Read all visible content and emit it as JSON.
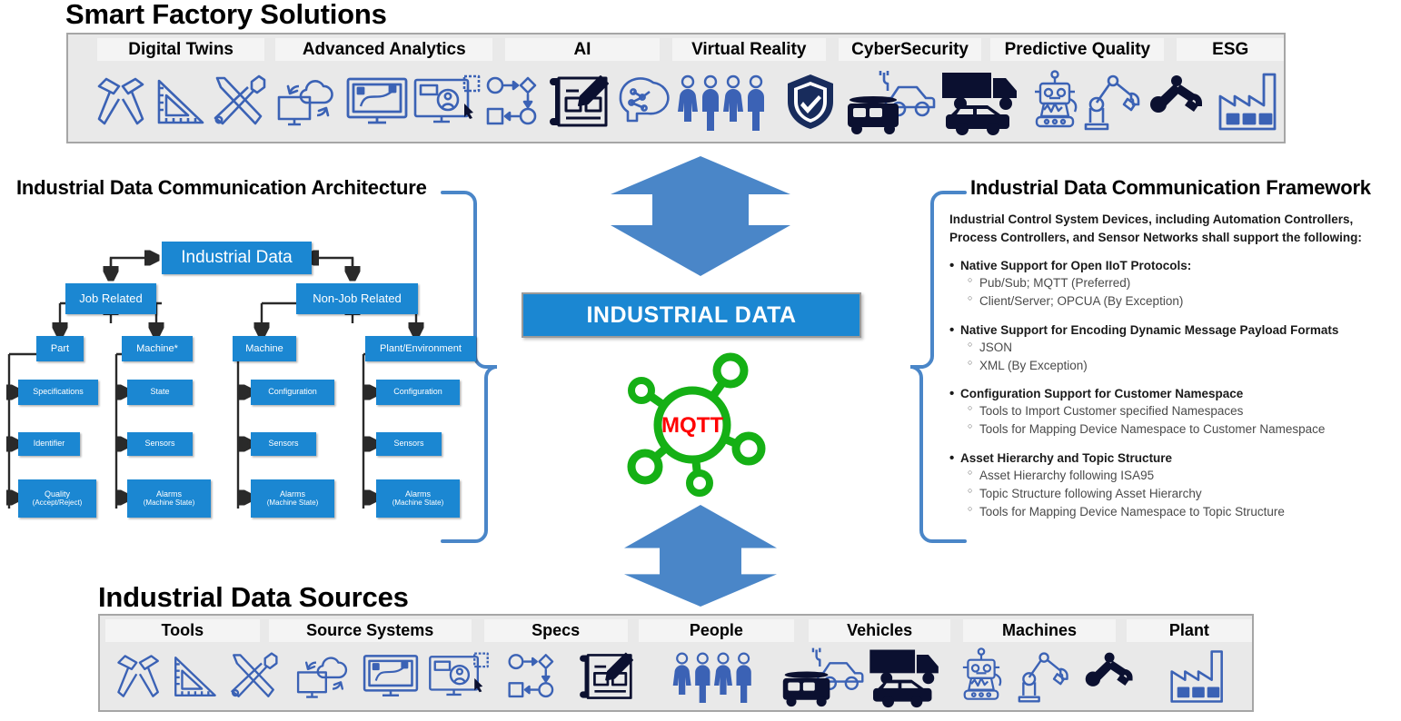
{
  "solutions": {
    "title": "Smart Factory Solutions",
    "categories": [
      {
        "label": "Digital Twins",
        "icons": [
          "hammers-icon",
          "ruler-triangle-icon",
          "tools-wrench-icon"
        ]
      },
      {
        "label": "Advanced Analytics",
        "icons": [
          "cloud-monitor-sync-icon",
          "monitor-curve-icon",
          "monitor-dashboard-user-icon"
        ]
      },
      {
        "label": "AI",
        "icons": [
          "flow-diagram-icon",
          "blueprint-pencil-icon",
          "ai-brain-head-icon"
        ]
      },
      {
        "label": "Virtual Reality",
        "icons": [
          "people-group-icon"
        ]
      },
      {
        "label": "CyberSecurity",
        "icons": [
          "shield-check-icon"
        ]
      },
      {
        "label": "Predictive Quality",
        "icons": [
          "ev-car-van-icon",
          "truck-car-icon",
          "robot-icon",
          "robot-arm-light-icon",
          "robot-arm-dark-icon"
        ]
      },
      {
        "label": "ESG",
        "icons": [
          "factory-icon"
        ]
      }
    ]
  },
  "sources": {
    "title": "Industrial Data Sources",
    "categories": [
      {
        "label": "Tools",
        "icons": [
          "hammers-icon",
          "ruler-triangle-icon",
          "tools-wrench-icon"
        ]
      },
      {
        "label": "Source Systems",
        "icons": [
          "cloud-monitor-sync-icon",
          "monitor-curve-icon",
          "monitor-dashboard-user-icon"
        ]
      },
      {
        "label": "Specs",
        "icons": [
          "flow-diagram-icon",
          "blueprint-pencil-icon"
        ]
      },
      {
        "label": "People",
        "icons": [
          "people-group-icon"
        ]
      },
      {
        "label": "Vehicles",
        "icons": [
          "ev-car-van-icon",
          "truck-car-icon"
        ]
      },
      {
        "label": "Machines",
        "icons": [
          "robot-icon",
          "robot-arm-light-icon",
          "robot-arm-dark-icon"
        ]
      },
      {
        "label": "Plant",
        "icons": [
          "factory-icon"
        ]
      }
    ]
  },
  "center": {
    "hub_label": "INDUSTRIAL DATA",
    "protocol_badge": "MQTT",
    "arrow_down": "arrow-down-icon",
    "arrow_up": "arrow-up-icon"
  },
  "architecture": {
    "title": "Industrial Data Communication Architecture",
    "root": "Industrial Data",
    "branches": [
      {
        "label": "Job Related",
        "children": [
          {
            "label": "Part",
            "leaves": [
              {
                "line1": "Specifications",
                "line2": ""
              },
              {
                "line1": "Identifier",
                "line2": ""
              },
              {
                "line1": "Quality",
                "line2": "(Accept/Reject)"
              }
            ]
          },
          {
            "label": "Machine*",
            "leaves": [
              {
                "line1": "State",
                "line2": ""
              },
              {
                "line1": "Sensors",
                "line2": ""
              },
              {
                "line1": "Alarms",
                "line2": "(Machine State)"
              }
            ]
          }
        ]
      },
      {
        "label": "Non-Job Related",
        "children": [
          {
            "label": "Machine",
            "leaves": [
              {
                "line1": "Configuration",
                "line2": ""
              },
              {
                "line1": "Sensors",
                "line2": ""
              },
              {
                "line1": "Alarms",
                "line2": "(Machine State)"
              }
            ]
          },
          {
            "label": "Plant/Environment",
            "leaves": [
              {
                "line1": "Configuration",
                "line2": ""
              },
              {
                "line1": "Sensors",
                "line2": ""
              },
              {
                "line1": "Alarms",
                "line2": "(Machine State)"
              }
            ]
          }
        ]
      }
    ]
  },
  "framework": {
    "title": "Industrial Data Communication Framework",
    "intro": "Industrial Control System Devices, including Automation Controllers, Process Controllers, and Sensor Networks shall support the following:",
    "groups": [
      {
        "heading": "Native Support for Open IIoT Protocols:",
        "items": [
          "Pub/Sub; MQTT (Preferred)",
          "Client/Server; OPCUA (By Exception)"
        ]
      },
      {
        "heading": "Native Support for Encoding Dynamic Message Payload Formats",
        "items": [
          "JSON",
          "XML (By Exception)"
        ]
      },
      {
        "heading": "Configuration Support for Customer Namespace",
        "items": [
          "Tools to Import Customer specified Namespaces",
          "Tools for Mapping Device Namespace to Customer Namespace"
        ]
      },
      {
        "heading": "Asset Hierarchy and Topic Structure",
        "items": [
          "Asset Hierarchy following ISA95",
          "Topic Structure following Asset Hierarchy",
          "Tools for Mapping Device Namespace to Topic Structure"
        ]
      }
    ]
  },
  "colors": {
    "accent_blue": "#1b87d2",
    "arrow_blue": "#4a86c8",
    "mqtt_green": "#15b015",
    "mqtt_red": "#ff0000",
    "strip_grey": "#e9e9e9",
    "icon_blue": "#3b62b5",
    "icon_navy": "#0b1030"
  }
}
